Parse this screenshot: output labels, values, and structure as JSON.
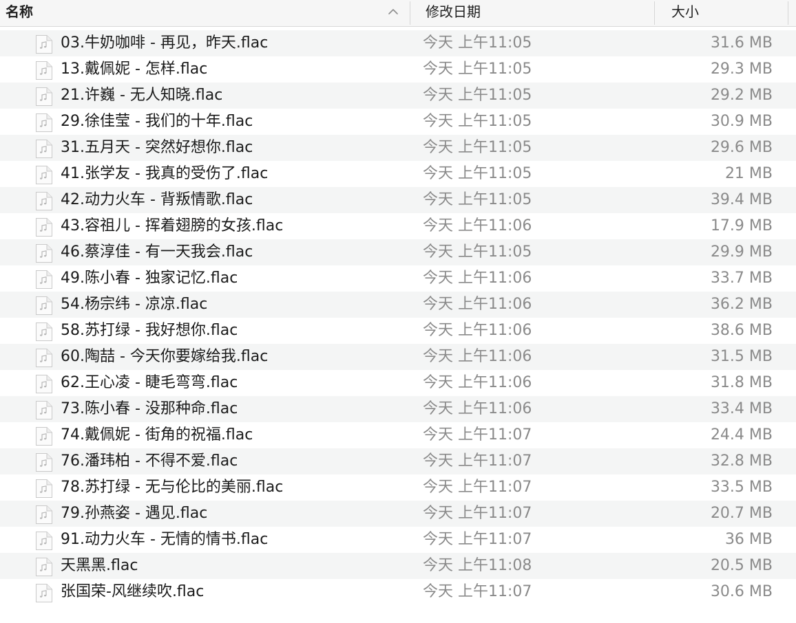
{
  "header": {
    "name_label": "名称",
    "date_label": "修改日期",
    "size_label": "大小",
    "sort_icon": "chevron-up-icon"
  },
  "colors": {
    "header_bg": "#f6f6f6",
    "stripe_bg": "#f4f5f5",
    "name_text": "#1a1a1a",
    "meta_text": "#8a8a8a"
  },
  "files": [
    {
      "name": "03.牛奶咖啡 - 再见，昨天.flac",
      "date": "今天 上午11:05",
      "size": "31.6 MB",
      "icon": "audio-file-icon"
    },
    {
      "name": "13.戴佩妮 - 怎样.flac",
      "date": "今天 上午11:05",
      "size": "29.3 MB",
      "icon": "audio-file-icon"
    },
    {
      "name": "21.许巍 - 无人知晓.flac",
      "date": "今天 上午11:05",
      "size": "29.2 MB",
      "icon": "audio-file-icon"
    },
    {
      "name": "29.徐佳莹 - 我们的十年.flac",
      "date": "今天 上午11:05",
      "size": "30.9 MB",
      "icon": "audio-file-icon"
    },
    {
      "name": "31.五月天 - 突然好想你.flac",
      "date": "今天 上午11:05",
      "size": "29.6 MB",
      "icon": "audio-file-icon"
    },
    {
      "name": "41.张学友 - 我真的受伤了.flac",
      "date": "今天 上午11:05",
      "size": "21 MB",
      "icon": "audio-file-icon"
    },
    {
      "name": "42.动力火车 - 背叛情歌.flac",
      "date": "今天 上午11:05",
      "size": "39.4 MB",
      "icon": "audio-file-icon"
    },
    {
      "name": "43.容祖儿 - 挥着翅膀的女孩.flac",
      "date": "今天 上午11:06",
      "size": "17.9 MB",
      "icon": "audio-file-icon"
    },
    {
      "name": "46.蔡淳佳 - 有一天我会.flac",
      "date": "今天 上午11:05",
      "size": "29.9 MB",
      "icon": "audio-file-icon"
    },
    {
      "name": "49.陈小春 - 独家记忆.flac",
      "date": "今天 上午11:06",
      "size": "33.7 MB",
      "icon": "audio-file-icon"
    },
    {
      "name": "54.杨宗纬 - 凉凉.flac",
      "date": "今天 上午11:06",
      "size": "36.2 MB",
      "icon": "audio-file-icon"
    },
    {
      "name": "58.苏打绿 - 我好想你.flac",
      "date": "今天 上午11:06",
      "size": "38.6 MB",
      "icon": "audio-file-icon"
    },
    {
      "name": "60.陶喆 - 今天你要嫁给我.flac",
      "date": "今天 上午11:06",
      "size": "31.5 MB",
      "icon": "audio-file-icon"
    },
    {
      "name": "62.王心凌 - 睫毛弯弯.flac",
      "date": "今天 上午11:06",
      "size": "31.8 MB",
      "icon": "audio-file-icon"
    },
    {
      "name": "73.陈小春 - 没那种命.flac",
      "date": "今天 上午11:06",
      "size": "33.4 MB",
      "icon": "audio-file-icon"
    },
    {
      "name": "74.戴佩妮 - 街角的祝福.flac",
      "date": "今天 上午11:07",
      "size": "24.4 MB",
      "icon": "audio-file-icon"
    },
    {
      "name": "76.潘玮柏 - 不得不爱.flac",
      "date": "今天 上午11:07",
      "size": "32.8 MB",
      "icon": "audio-file-icon"
    },
    {
      "name": "78.苏打绿 - 无与伦比的美丽.flac",
      "date": "今天 上午11:07",
      "size": "33.5 MB",
      "icon": "audio-file-icon"
    },
    {
      "name": "79.孙燕姿 - 遇见.flac",
      "date": "今天 上午11:07",
      "size": "20.7 MB",
      "icon": "audio-file-icon"
    },
    {
      "name": "91.动力火车 - 无情的情书.flac",
      "date": "今天 上午11:07",
      "size": "36 MB",
      "icon": "audio-file-icon"
    },
    {
      "name": "天黑黑.flac",
      "date": "今天 上午11:08",
      "size": "20.5 MB",
      "icon": "audio-file-icon"
    },
    {
      "name": "张国荣-风继续吹.flac",
      "date": "今天 上午11:07",
      "size": "30.6 MB",
      "icon": "audio-file-icon"
    }
  ]
}
